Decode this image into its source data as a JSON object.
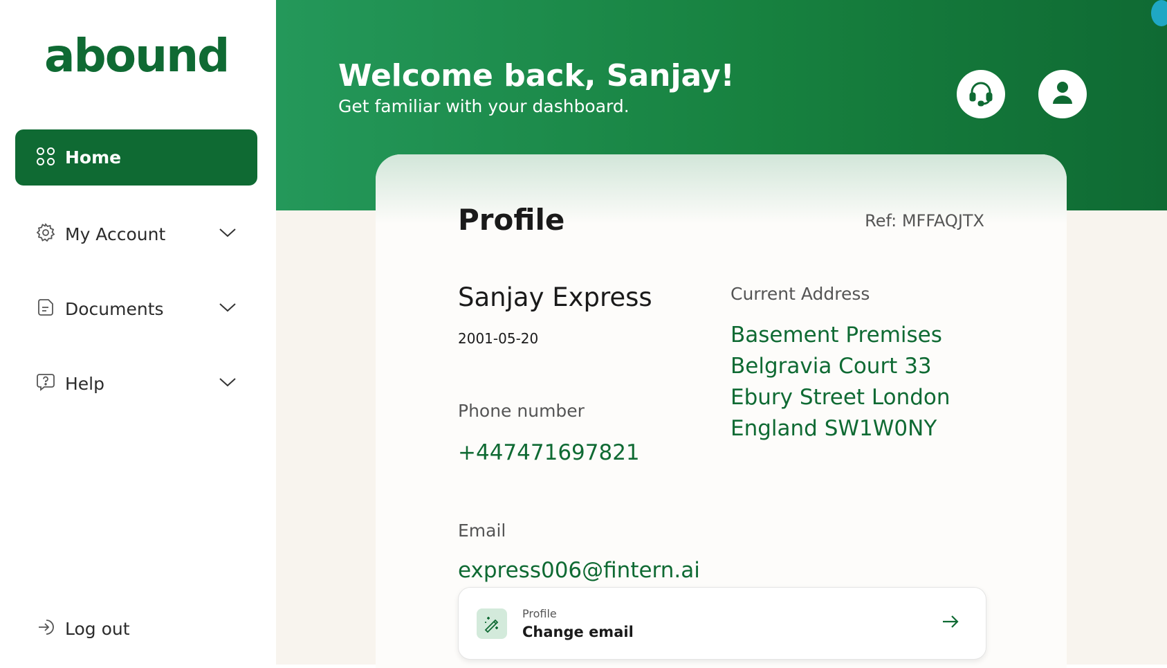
{
  "sidebar": {
    "logo": "abound",
    "items": [
      {
        "label": "Home",
        "icon": "grid-icon",
        "active": true
      },
      {
        "label": "My Account",
        "icon": "gear-icon"
      },
      {
        "label": "Documents",
        "icon": "document-icon"
      },
      {
        "label": "Help",
        "icon": "help-bubble-icon"
      }
    ],
    "logout": "Log out"
  },
  "header": {
    "welcome": "Welcome back, Sanjay!",
    "subtitle": "Get familiar with your dashboard.",
    "support_icon": "headset-icon",
    "user_icon": "user-icon"
  },
  "profile": {
    "title": "Profile",
    "ref": "Ref: MFFAQJTX",
    "name": "Sanjay Express",
    "dob": "2001-05-20",
    "phone_label": "Phone number",
    "phone": "+447471697821",
    "email_label": "Email",
    "email": "express006@fintern.ai",
    "address_label": "Current Address",
    "address_lines": [
      "Basement Premises",
      "Belgravia Court 33",
      "Ebury Street London",
      "England SW1W0NY"
    ]
  },
  "action": {
    "subtitle": "Profile",
    "title": "Change email"
  },
  "colors": {
    "brand": "#0f6a33",
    "header_light": "#24985a",
    "background": "#f8f4ee"
  }
}
